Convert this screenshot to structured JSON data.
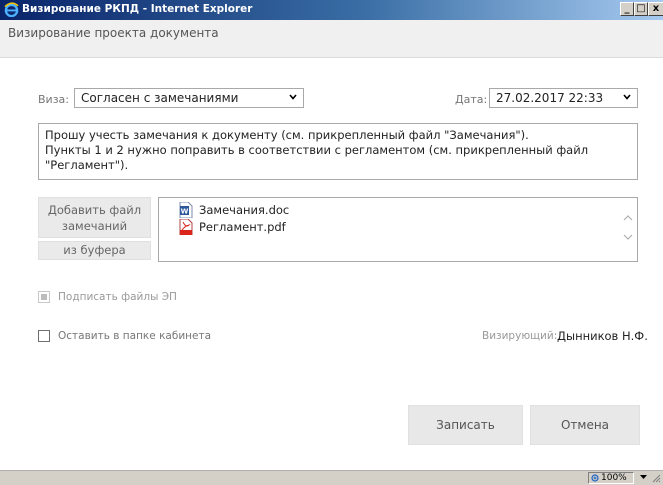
{
  "window": {
    "title": "Визирование РКПД - Internet Explorer",
    "minimize": "_",
    "maximize": "□",
    "close": "x"
  },
  "dialog": {
    "header": "Визирование проекта документа"
  },
  "form": {
    "visa_label": "Виза:",
    "visa_value": "Согласен с замечаниями",
    "date_label": "Дата:",
    "date_value": "27.02.2017 22:33",
    "comment_line1": "Прошу учесть замечания к документу (см. прикрепленный файл \"Замечания\").",
    "comment_line2": "Пункты 1 и 2 нужно поправить в соответствии с регламентом (см. прикрепленный файл \"Регламент\").",
    "add_file_line1": "Добавить файл",
    "add_file_line2": "замечаний",
    "from_buffer": "из буфера",
    "files": [
      {
        "name": "Замечания.doc",
        "icon": "word-doc-icon"
      },
      {
        "name": "Регламент.pdf",
        "icon": "pdf-icon"
      }
    ],
    "sign_files_label": "Подписать файлы ЭП",
    "keep_in_folder_label": "Оставить в папке кабинета",
    "signer_label": "Визирующий:",
    "signer_value": "Дынников Н.Ф.",
    "save_button": "Записать",
    "cancel_button": "Отмена"
  },
  "statusbar": {
    "zoom": "100%"
  },
  "colors": {
    "titlebar_start": "#0a246a",
    "titlebar_end": "#a6caf0",
    "button_bg": "#e8e8e8",
    "pdf_red": "#d9251c",
    "word_blue": "#2b579a"
  }
}
